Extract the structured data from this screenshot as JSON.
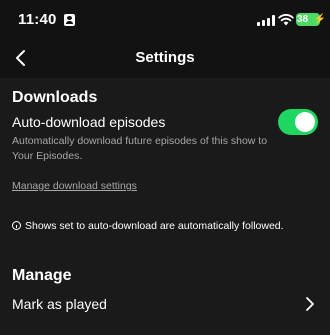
{
  "status_bar": {
    "time": "11:40",
    "battery": "38",
    "icons": [
      "contact-card-icon",
      "signal-icon",
      "wifi-icon",
      "battery-icon"
    ]
  },
  "header": {
    "title": "Settings",
    "back_icon": "chevron-left-icon"
  },
  "downloads": {
    "section_title": "Downloads",
    "auto_download_label": "Auto-download episodes",
    "auto_download_desc": "Automatically download future episodes of this show to Your Episodes.",
    "auto_download_enabled": true,
    "manage_link": "Manage download settings",
    "info_icon": "info-circle-icon",
    "info_text": "Shows set to auto-download are automatically followed."
  },
  "manage": {
    "section_title": "Manage",
    "mark_played_label": "Mark as played",
    "chevron_icon": "chevron-right-icon"
  },
  "colors": {
    "background": "#121212",
    "panel": "#1a1a1a",
    "accent": "#1ed760",
    "secondary_text": "#a7a7a7",
    "battery": "#4cd964"
  }
}
